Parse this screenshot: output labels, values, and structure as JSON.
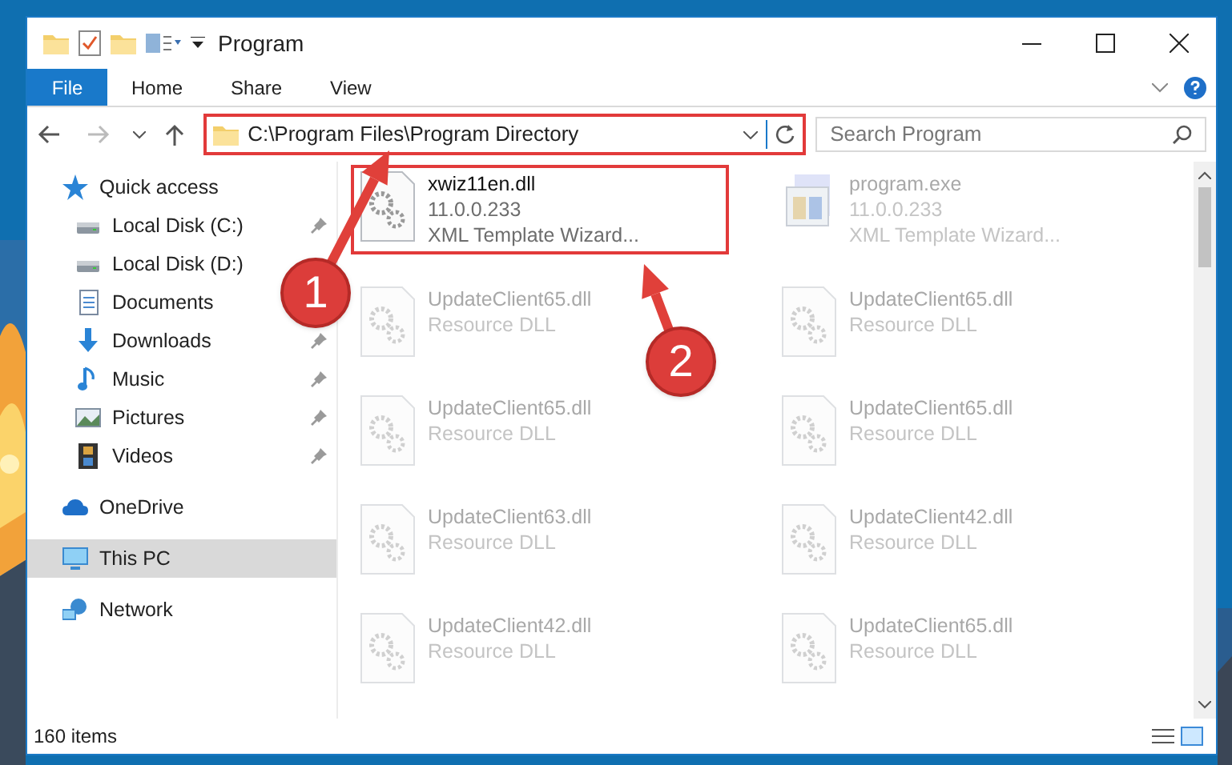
{
  "window": {
    "title": "Program"
  },
  "ribbon_tabs": [
    {
      "label": "File",
      "selected": true
    },
    {
      "label": "Home",
      "selected": false
    },
    {
      "label": "Share",
      "selected": false
    },
    {
      "label": "View",
      "selected": false
    }
  ],
  "address_bar": {
    "path": "C:\\Program Files\\Program Directory",
    "highlighted": true
  },
  "search": {
    "placeholder": "Search Program"
  },
  "sidebar": {
    "items": [
      {
        "label": "Quick access",
        "selected": false,
        "children": [
          {
            "label": "Local Disk (C:)",
            "pinned": true,
            "selected": false
          },
          {
            "label": "Local Disk (D:)",
            "pinned": false,
            "selected": false
          },
          {
            "label": "Documents",
            "pinned": false,
            "selected": false
          },
          {
            "label": "Downloads",
            "pinned": true,
            "selected": false
          },
          {
            "label": "Music",
            "pinned": true,
            "selected": false
          },
          {
            "label": "Pictures",
            "pinned": true,
            "selected": false
          },
          {
            "label": "Videos",
            "pinned": true,
            "selected": false
          }
        ]
      },
      {
        "label": "OneDrive",
        "selected": false
      },
      {
        "label": "This PC",
        "selected": true
      },
      {
        "label": "Network",
        "selected": false
      }
    ]
  },
  "files": [
    {
      "name": "xwiz11en.dll",
      "details": [
        "11.0.0.233",
        "XML Template Wizard..."
      ],
      "dimmed": false,
      "highlighted": true
    },
    {
      "name": "program.exe",
      "details": [
        "11.0.0.233",
        "XML Template Wizard..."
      ],
      "dimmed": true,
      "highlighted": false
    },
    {
      "name": "UpdateClient65.dll",
      "details": [
        "Resource DLL"
      ],
      "dimmed": true,
      "highlighted": false
    },
    {
      "name": "UpdateClient65.dll",
      "details": [
        "Resource DLL"
      ],
      "dimmed": true,
      "highlighted": false
    },
    {
      "name": "UpdateClient65.dll",
      "details": [
        "Resource DLL"
      ],
      "dimmed": true,
      "highlighted": false
    },
    {
      "name": "UpdateClient65.dll",
      "details": [
        "Resource DLL"
      ],
      "dimmed": true,
      "highlighted": false
    },
    {
      "name": "UpdateClient63.dll",
      "details": [
        "Resource DLL"
      ],
      "dimmed": true,
      "highlighted": false
    },
    {
      "name": "UpdateClient42.dll",
      "details": [
        "Resource DLL"
      ],
      "dimmed": true,
      "highlighted": false
    },
    {
      "name": "UpdateClient42.dll",
      "details": [
        "Resource DLL"
      ],
      "dimmed": true,
      "highlighted": false
    },
    {
      "name": "UpdateClient65.dll",
      "details": [
        "Resource DLL"
      ],
      "dimmed": true,
      "highlighted": false
    }
  ],
  "status_bar": {
    "item_count": "160 items"
  },
  "annotations": [
    {
      "label": "1"
    },
    {
      "label": "2"
    }
  ]
}
